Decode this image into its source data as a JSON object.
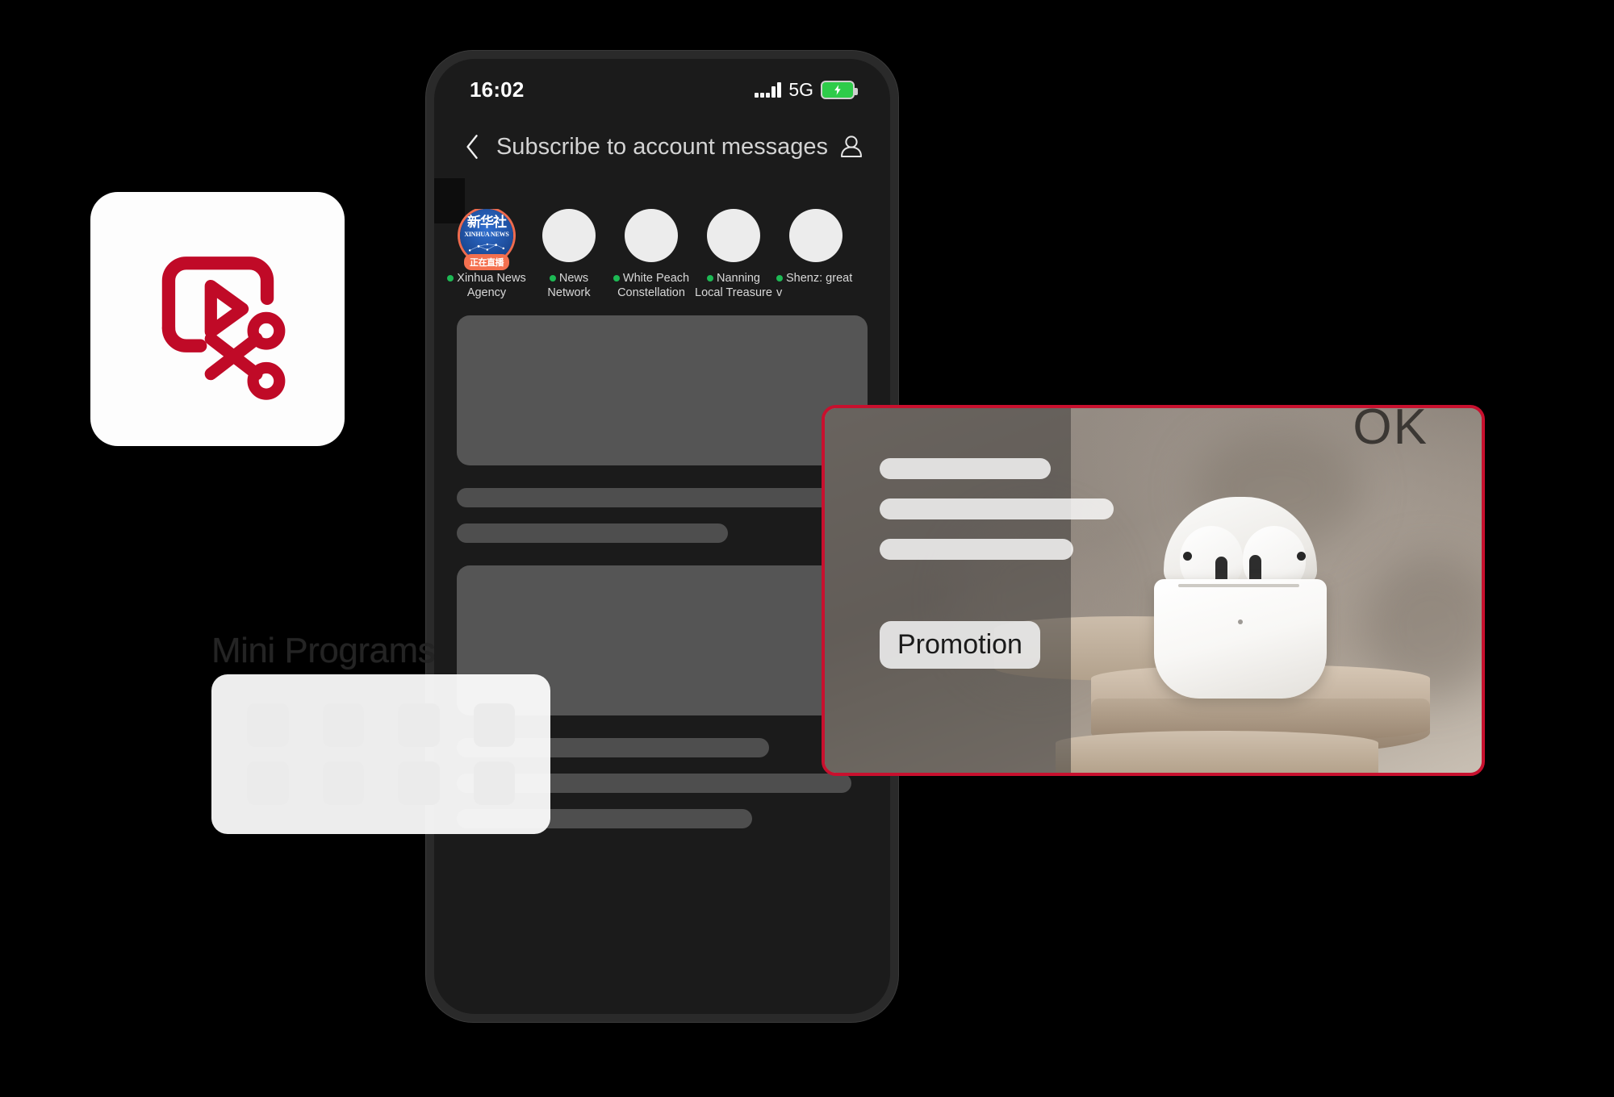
{
  "app_icon": {
    "name": "video-share-app-icon",
    "accent": "#C00A27"
  },
  "phone": {
    "status_bar": {
      "time": "16:02",
      "network": "5G",
      "battery_state": "charging"
    },
    "nav": {
      "back_icon": "chevron-left-icon",
      "title": "Subscribe to account messages",
      "profile_icon": "person-icon"
    },
    "accounts": [
      {
        "name": "Xinhua News Agency",
        "live_badge": "正在直播",
        "logo_cn": "新华社",
        "logo_en": "XINHUA NEWS",
        "online": true
      },
      {
        "name": "News Network",
        "online": true
      },
      {
        "name": "White Peach Constellation",
        "online": true
      },
      {
        "name": "Nanning Local Treasure",
        "online": true
      },
      {
        "name": "Shenz: great v",
        "online": true
      }
    ]
  },
  "mini_programs": {
    "label": "Mini Programs",
    "icon": "grid-squares-icon",
    "tile_count": 8
  },
  "promotion": {
    "border_color": "#C8102E",
    "button_label": "Promotion",
    "corner_text": "OK",
    "product": "wireless-earbuds-in-case",
    "placeholder_lines": 3
  }
}
